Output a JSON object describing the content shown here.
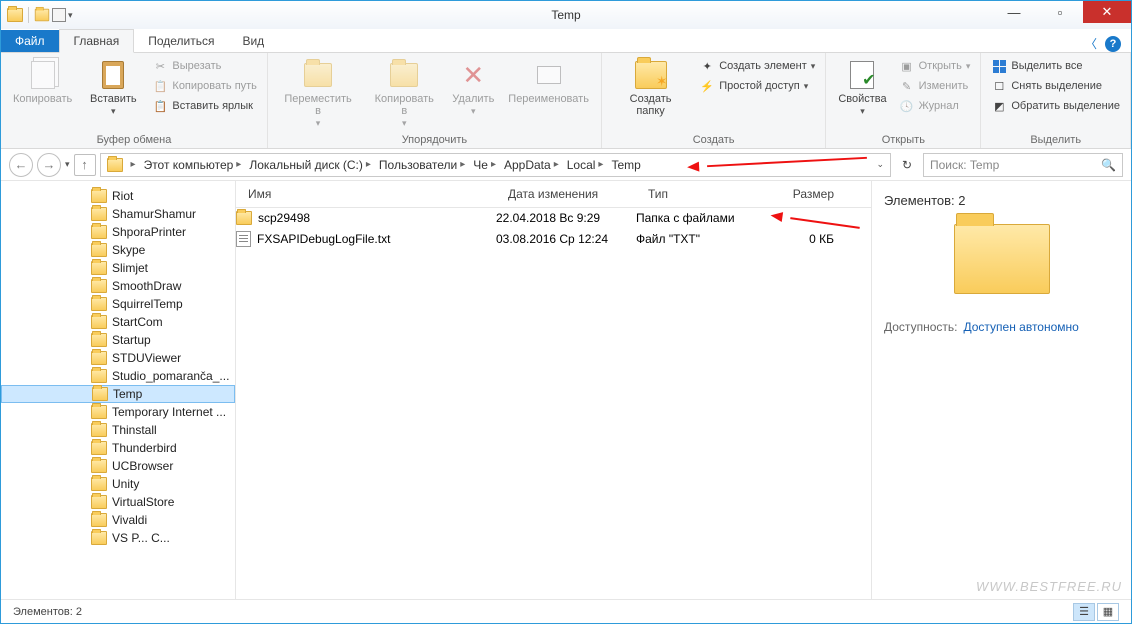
{
  "window": {
    "title": "Temp"
  },
  "tabs": {
    "file": "Файл",
    "home": "Главная",
    "share": "Поделиться",
    "view": "Вид"
  },
  "ribbon": {
    "clipboard": {
      "label": "Буфер обмена",
      "copy": "Копировать",
      "paste": "Вставить",
      "cut": "Вырезать",
      "copypath": "Копировать путь",
      "pasteshortcut": "Вставить ярлык"
    },
    "organize": {
      "label": "Упорядочить",
      "moveto": "Переместить в",
      "copyto": "Копировать в",
      "delete": "Удалить",
      "rename": "Переименовать"
    },
    "new": {
      "label": "Создать",
      "newfolder": "Создать папку",
      "newitem": "Создать элемент",
      "easyaccess": "Простой доступ"
    },
    "open": {
      "label": "Открыть",
      "properties": "Свойства",
      "open": "Открыть",
      "edit": "Изменить",
      "history": "Журнал"
    },
    "select": {
      "label": "Выделить",
      "selectall": "Выделить все",
      "selectnone": "Снять выделение",
      "invert": "Обратить выделение"
    }
  },
  "breadcrumbs": [
    "Этот компьютер",
    "Локальный диск (C:)",
    "Пользователи",
    "Че",
    "AppData",
    "Local",
    "Temp"
  ],
  "search": {
    "placeholder": "Поиск: Temp"
  },
  "tree": {
    "items": [
      "Riot",
      "ShamurShamur",
      "ShporaPrinter",
      "Skype",
      "Slimjet",
      "SmoothDraw",
      "SquirrelTemp",
      "StartCom",
      "Startup",
      "STDUViewer",
      "Studio_pomaranča_...",
      "Temp",
      "Temporary Internet ...",
      "Thinstall",
      "Thunderbird",
      "UCBrowser",
      "Unity",
      "VirtualStore",
      "Vivaldi",
      "VS P... C..."
    ],
    "selected": "Temp"
  },
  "columns": {
    "name": "Имя",
    "date": "Дата изменения",
    "type": "Тип",
    "size": "Размер"
  },
  "files": [
    {
      "name": "scp29498",
      "date": "22.04.2018 Вс 9:29",
      "type": "Папка с файлами",
      "size": "",
      "icon": "folder"
    },
    {
      "name": "FXSAPIDebugLogFile.txt",
      "date": "03.08.2016 Ср 12:24",
      "type": "Файл \"TXT\"",
      "size": "0 КБ",
      "icon": "txt"
    }
  ],
  "preview": {
    "header": "Элементов: 2",
    "avail_k": "Доступность:",
    "avail_v": "Доступен автономно"
  },
  "status": {
    "count": "Элементов: 2"
  },
  "watermark": "WWW.BESTFREE.RU"
}
